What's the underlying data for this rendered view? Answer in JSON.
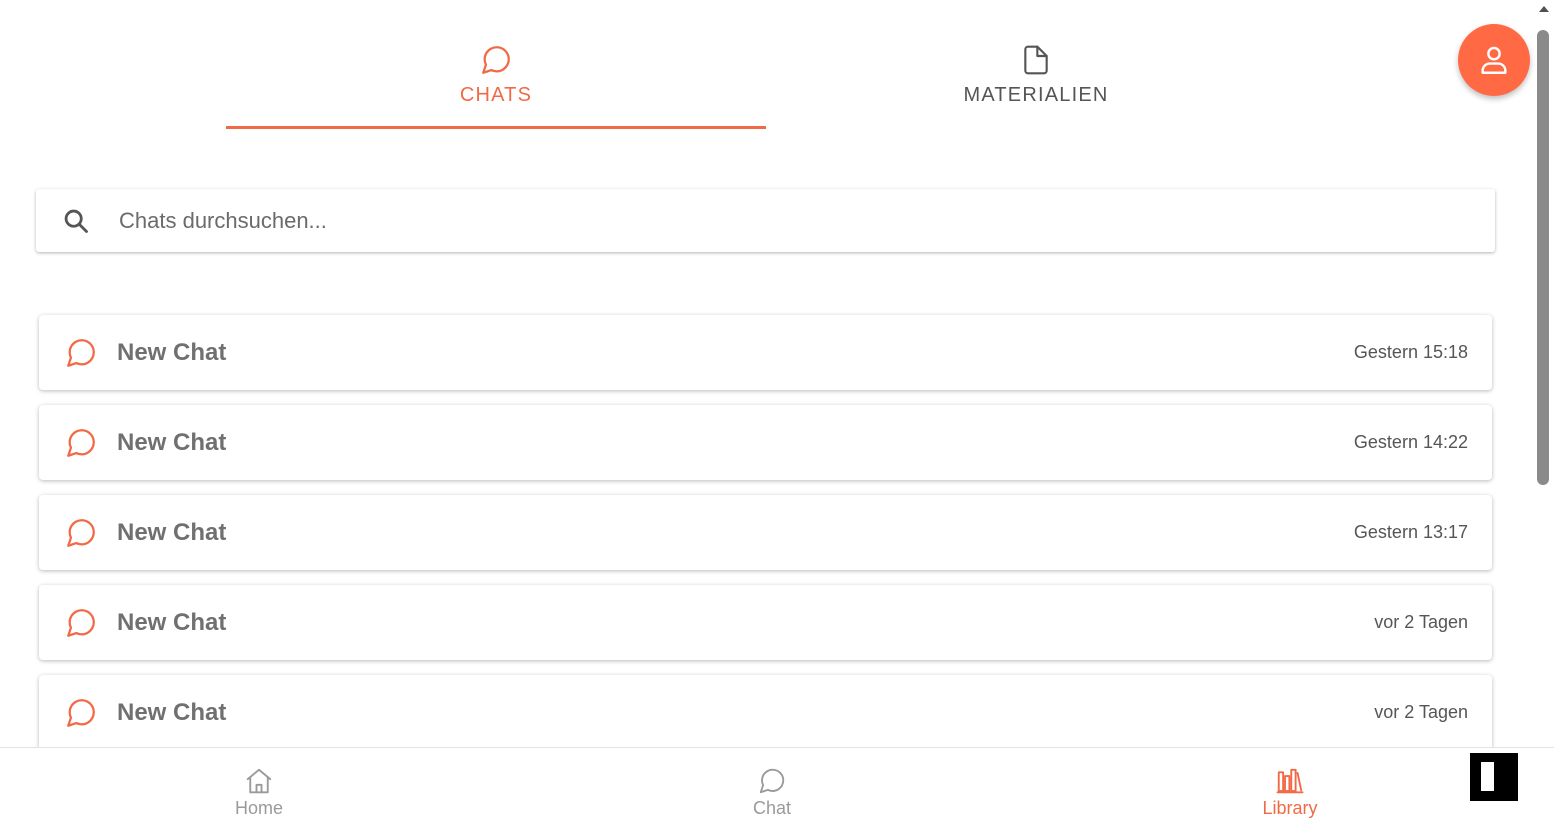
{
  "tabs": [
    {
      "label": "CHATS",
      "icon": "chat-bubble-icon",
      "active": true
    },
    {
      "label": "MATERIALIEN",
      "icon": "document-icon",
      "active": false
    }
  ],
  "search": {
    "placeholder": "Chats durchsuchen...",
    "value": ""
  },
  "chats": [
    {
      "title": "New Chat",
      "time": "Gestern 15:18"
    },
    {
      "title": "New Chat",
      "time": "Gestern 14:22"
    },
    {
      "title": "New Chat",
      "time": "Gestern 13:17"
    },
    {
      "title": "New Chat",
      "time": "vor 2 Tagen"
    },
    {
      "title": "New Chat",
      "time": "vor 2 Tagen"
    }
  ],
  "nav": {
    "home": {
      "label": "Home",
      "icon": "home-icon"
    },
    "chat": {
      "label": "Chat",
      "icon": "chat-bubble-icon"
    },
    "library": {
      "label": "Library",
      "icon": "library-icon",
      "active": true
    }
  },
  "colors": {
    "accent": "#f26a45",
    "avatar_bg": "#ff6a45",
    "muted": "#9a9a9a"
  }
}
